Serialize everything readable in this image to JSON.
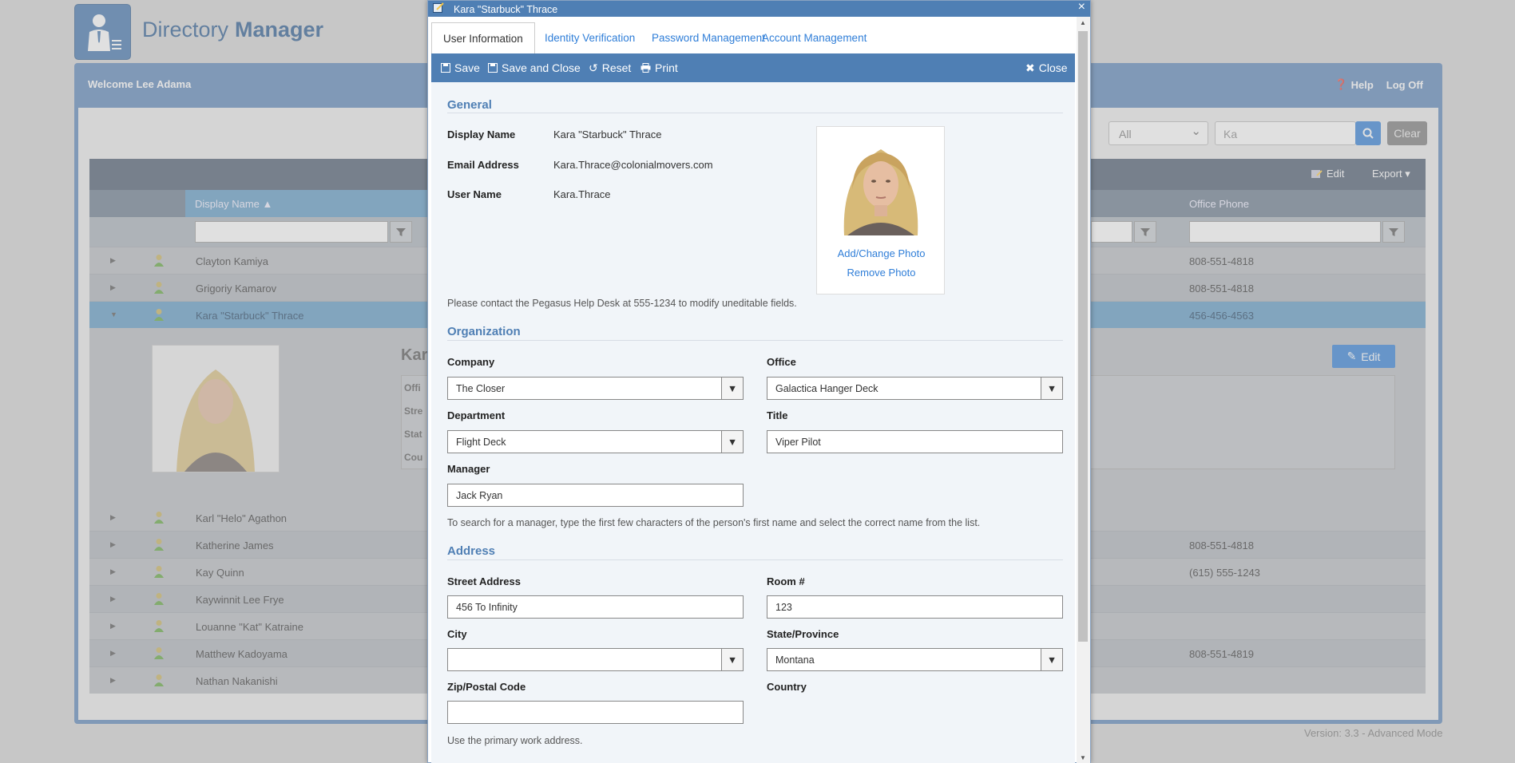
{
  "app": {
    "brand_part1": "Directory",
    "brand_part2": "Manager",
    "welcome": "Welcome Lee Adama",
    "help": "Help",
    "logoff": "Log Off",
    "filter_select": "All",
    "search_value": "Ka",
    "clear": "Clear",
    "grid_edit": "Edit",
    "grid_export": "Export",
    "col_display_name": "Display Name",
    "col_office_phone": "Office Phone",
    "rows": [
      {
        "name": "Clayton Kamiya",
        "phone": "808-551-4818"
      },
      {
        "name": "Grigoriy Kamarov",
        "phone": "808-551-4818"
      },
      {
        "name": "Kara \"Starbuck\" Thrace",
        "phone": "456-456-4563"
      },
      {
        "name": "Karl \"Helo\" Agathon",
        "phone": ""
      },
      {
        "name": "Katherine James",
        "phone": "808-551-4818"
      },
      {
        "name": "Kay Quinn",
        "phone": "(615) 555-1243"
      },
      {
        "name": "Kaywinnit Lee Frye",
        "phone": ""
      },
      {
        "name": "Louanne \"Kat\" Katraine",
        "phone": ""
      },
      {
        "name": "Matthew Kadoyama",
        "phone": "808-551-4819"
      },
      {
        "name": "Nathan Nakanishi",
        "phone": ""
      }
    ],
    "detail_name_partial": "Kar",
    "detail_labels": [
      "Offi",
      "Stre",
      "Stat",
      "Cou"
    ],
    "detail_edit": "Edit",
    "detail_value_partial": "n",
    "version": "Version: 3.3 - Advanced Mode"
  },
  "dialog": {
    "title": "Kara \"Starbuck\" Thrace",
    "close_x": "×",
    "tabs": [
      "User Information",
      "Identity Verification",
      "Password Management",
      "Account Management"
    ],
    "toolbar": {
      "save": "Save",
      "save_close": "Save and Close",
      "reset": "Reset",
      "print": "Print",
      "close": "Close"
    },
    "general": {
      "heading": "General",
      "display_name_label": "Display Name",
      "display_name": "Kara \"Starbuck\" Thrace",
      "email_label": "Email Address",
      "email": "Kara.Thrace@colonialmovers.com",
      "username_label": "User Name",
      "username": "Kara.Thrace",
      "add_photo": "Add/Change Photo",
      "remove_photo": "Remove Photo",
      "note": "Please contact the Pegasus Help Desk at 555-1234 to modify uneditable fields."
    },
    "organization": {
      "heading": "Organization",
      "company_label": "Company",
      "company": "The Closer",
      "office_label": "Office",
      "office": "Galactica Hanger Deck",
      "department_label": "Department",
      "department": "Flight Deck",
      "title_label": "Title",
      "title": "Viper Pilot",
      "manager_label": "Manager",
      "manager": "Jack Ryan",
      "note": "To search for a manager, type the first few characters of the person's first name and select the correct name from the list."
    },
    "address": {
      "heading": "Address",
      "street_label": "Street Address",
      "street": "456 To Infinity",
      "room_label": "Room #",
      "room": "123",
      "city_label": "City",
      "city": "",
      "state_label": "State/Province",
      "state": "Montana",
      "zip_label": "Zip/Postal Code",
      "zip": "",
      "country_label": "Country",
      "note": "Use the primary work address."
    }
  }
}
